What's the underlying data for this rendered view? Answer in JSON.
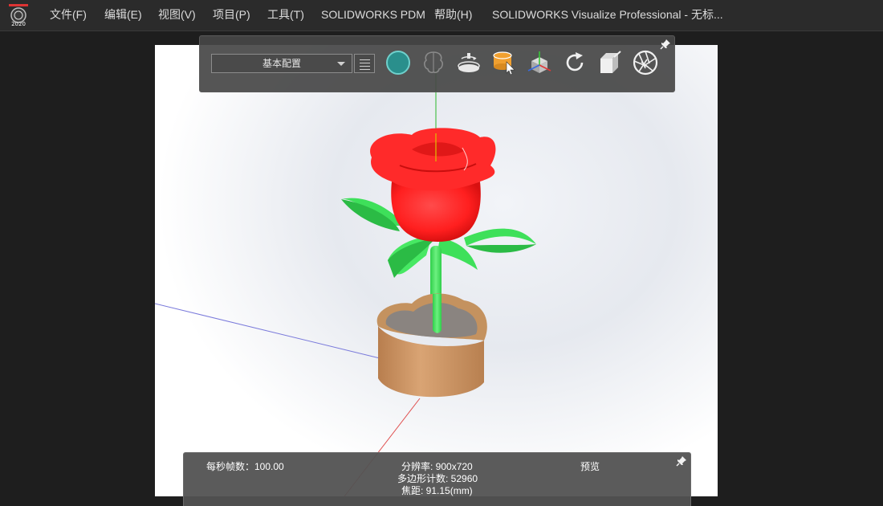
{
  "app": {
    "logo_year": "2020",
    "title": "SOLIDWORKS Visualize Professional - 无标..."
  },
  "menu": [
    {
      "label": "文件(F)"
    },
    {
      "label": "编辑(E)"
    },
    {
      "label": "视图(V)"
    },
    {
      "label": "项目(P)"
    },
    {
      "label": "工具(T)"
    },
    {
      "label": "SOLIDWORKS PDM"
    },
    {
      "label": "帮助(H)"
    }
  ],
  "toolbar": {
    "configuration": "基本配置",
    "icons": [
      "sphere-icon",
      "brain-icon",
      "turntable-icon",
      "select-part-icon",
      "axis-cube-icon",
      "refresh-icon",
      "box-camera-icon",
      "aperture-icon"
    ]
  },
  "status": {
    "fps": "每秒帧数：100.00",
    "resolution": "分辨率: 900x720",
    "polygons": "多边形计数: 52960",
    "focal": "焦距: 91.15(mm)",
    "mode": "预览"
  },
  "colors": {
    "petal": "#ff2a2a",
    "leaf": "#3ee05a",
    "pot": "#c8905e",
    "soil": "#8a8480"
  }
}
